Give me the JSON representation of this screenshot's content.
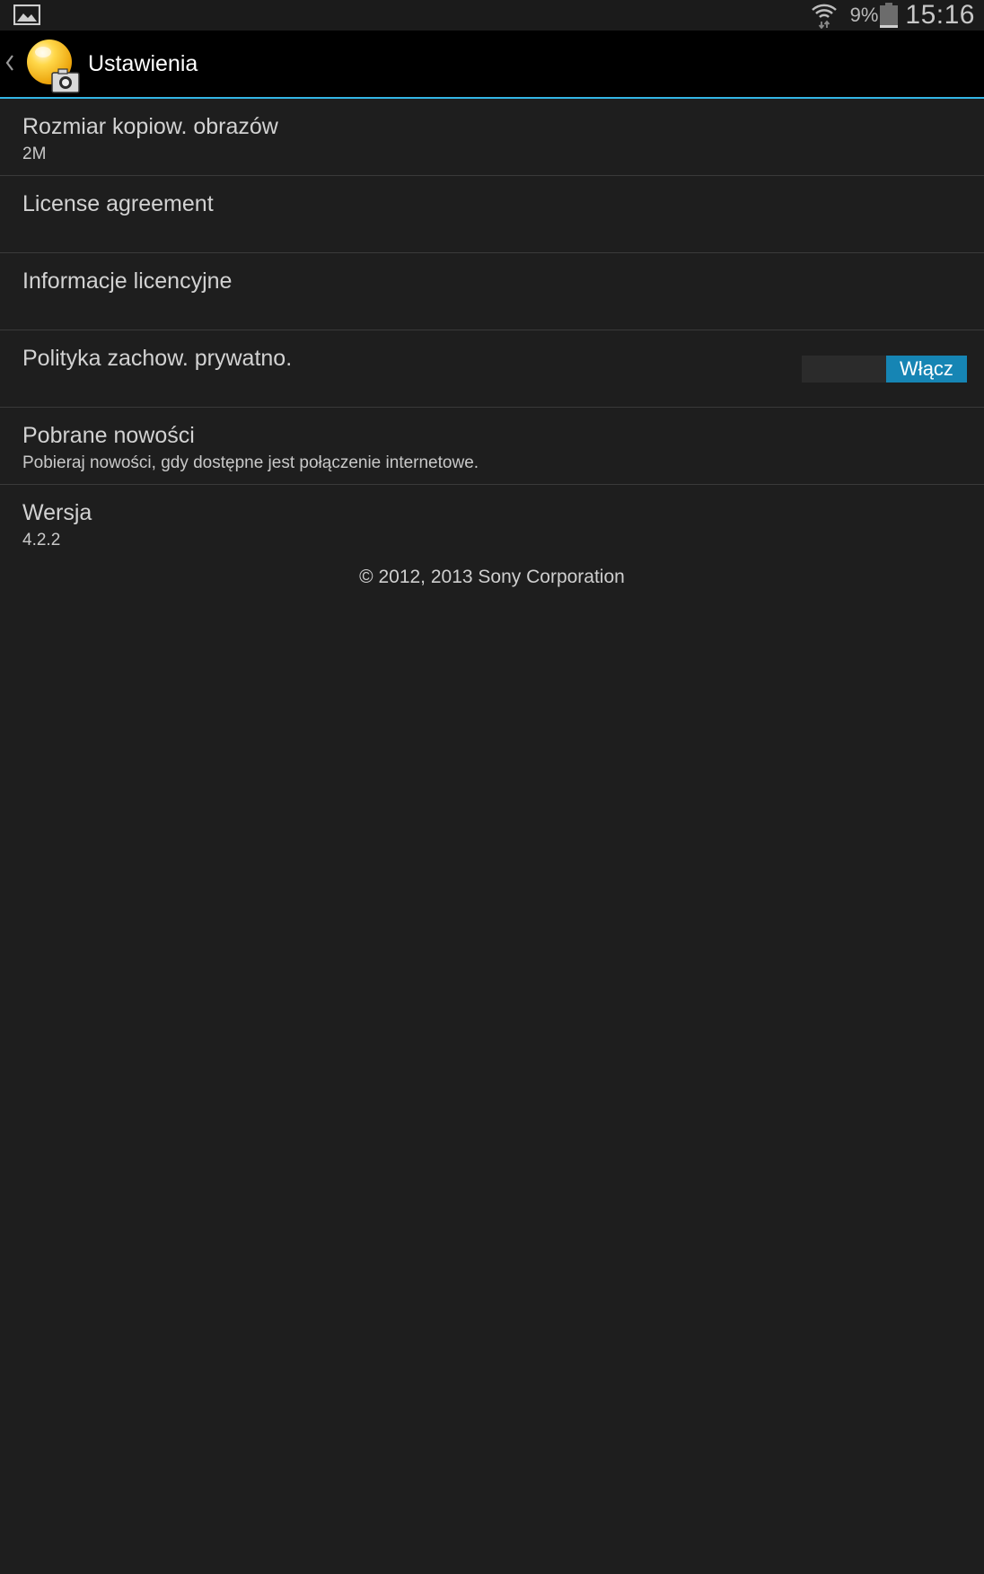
{
  "status_bar": {
    "notification_icon": "gallery-icon",
    "wifi_icon": "wifi-icon",
    "battery_percent": "9%",
    "battery_icon": "battery-icon",
    "time": "15:16"
  },
  "action_bar": {
    "back_icon": "chevron-left-icon",
    "app_icon": "app-camera-globe-icon",
    "title": "Ustawienia",
    "underline_color": "#33b5e5"
  },
  "settings": [
    {
      "title": "Rozmiar kopiow. obrazów",
      "summary": "2M"
    },
    {
      "title": "License agreement",
      "summary": ""
    },
    {
      "title": "Informacje licencyjne",
      "summary": ""
    },
    {
      "title": "Polityka zachow. prywatno.",
      "summary": ""
    },
    {
      "title": "Pobrane nowości",
      "summary": "Pobieraj nowości, gdy dostępne jest połączenie internetowe.",
      "toggle": {
        "state": "on",
        "label": "Włącz",
        "color": "#1685b4"
      }
    },
    {
      "title": "Wersja",
      "summary": "4.2.2"
    }
  ],
  "copyright": "© 2012, 2013 Sony Corporation"
}
